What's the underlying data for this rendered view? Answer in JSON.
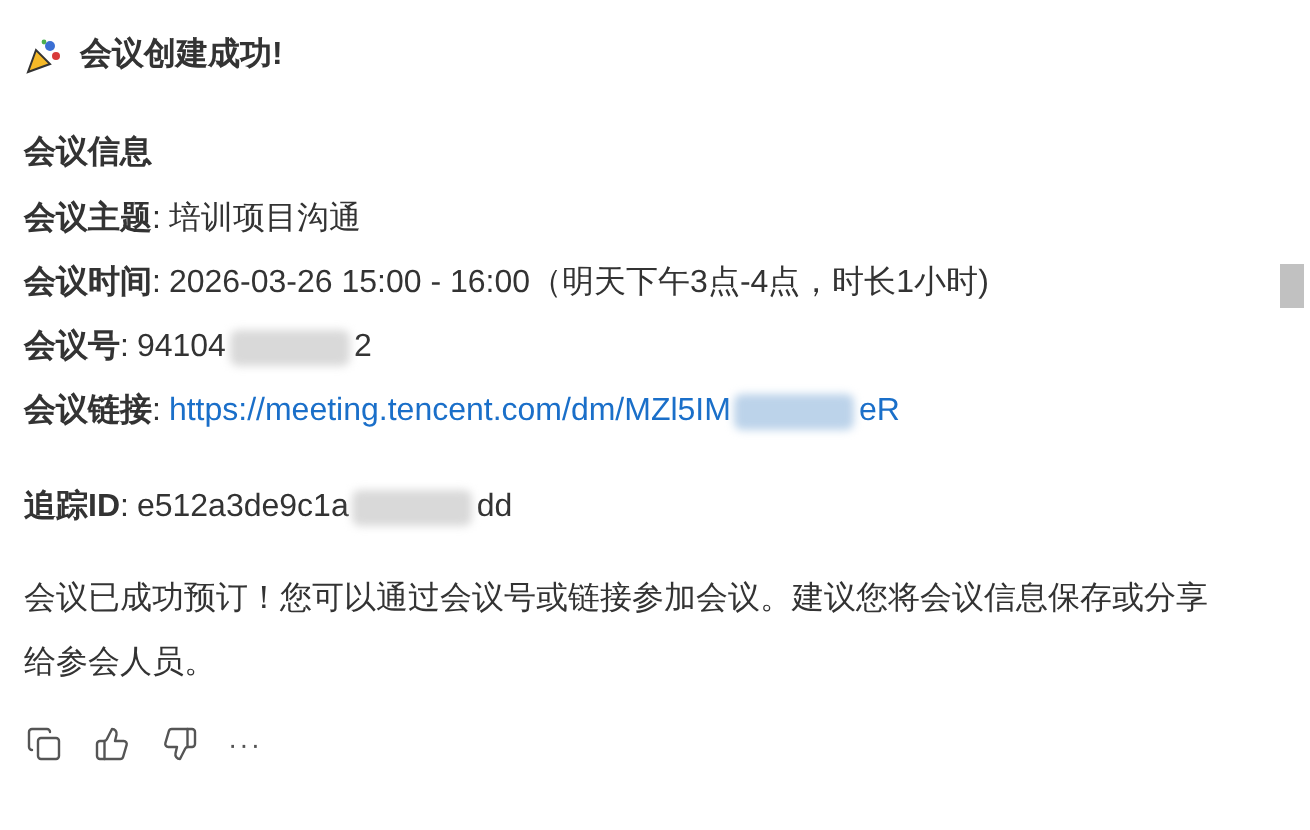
{
  "message": {
    "title": "会议创建成功!",
    "section_heading": "会议信息",
    "fields": [
      {
        "label": "会议主题",
        "separator": ":",
        "kind": "text",
        "parts": [
          "培训项目沟通"
        ]
      },
      {
        "label": "会议时间",
        "separator": ":",
        "kind": "text",
        "parts": [
          "2026-03-26 15:00 - 16:00（明天下午3点-4点，时长1小时)"
        ]
      },
      {
        "label": "会议号",
        "separator": ":",
        "kind": "text",
        "parts": [
          "94104",
          "2"
        ]
      },
      {
        "label": "会议链接",
        "separator": ":",
        "kind": "link",
        "parts": [
          "https://meeting.tencent.com/dm/MZl5IM",
          "eR"
        ]
      }
    ],
    "trace": {
      "label": "追踪ID",
      "separator": ":",
      "kind": "text",
      "parts": [
        "e512a3de9c1a",
        "dd"
      ]
    },
    "body": "会议已成功预订！您可以通过会议号或链接参加会议。建议您将会议信息保存或分享给参会人员。"
  },
  "actions": [
    {
      "kind": "copy"
    },
    {
      "kind": "like"
    },
    {
      "kind": "dislike"
    },
    {
      "kind": "more",
      "label": "···"
    }
  ]
}
